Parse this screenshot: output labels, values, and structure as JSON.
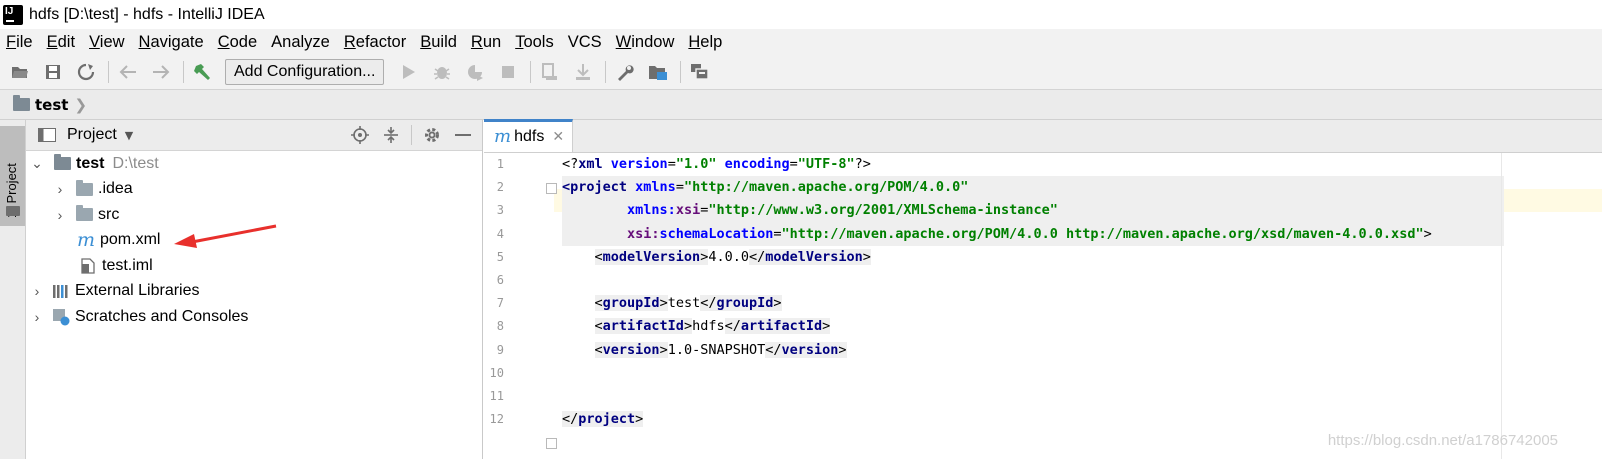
{
  "window": {
    "title": "hdfs [D:\\test] - hdfs - IntelliJ IDEA"
  },
  "menu": [
    {
      "mnemonic": "F",
      "rest": "ile"
    },
    {
      "mnemonic": "E",
      "rest": "dit"
    },
    {
      "mnemonic": "V",
      "rest": "iew"
    },
    {
      "mnemonic": "N",
      "rest": "avigate"
    },
    {
      "mnemonic": "C",
      "rest": "ode"
    },
    {
      "mnemonic": "",
      "rest": "Analyze"
    },
    {
      "mnemonic": "R",
      "rest": "efactor"
    },
    {
      "mnemonic": "B",
      "rest": "uild"
    },
    {
      "mnemonic": "R",
      "rest": "un"
    },
    {
      "mnemonic": "T",
      "rest": "ools"
    },
    {
      "mnemonic": "",
      "rest": "VCS"
    },
    {
      "mnemonic": "W",
      "rest": "indow"
    },
    {
      "mnemonic": "H",
      "rest": "elp"
    }
  ],
  "toolbar": {
    "add_configuration": "Add Configuration..."
  },
  "breadcrumb": {
    "root": "test"
  },
  "left_stripe": {
    "project_tab": "1: Project"
  },
  "project_panel": {
    "title": "Project",
    "tree": {
      "root_name": "test",
      "root_path": "D:\\test",
      "idea": ".idea",
      "src": "src",
      "pom": "pom.xml",
      "iml": "test.iml",
      "external": "External Libraries",
      "scratches": "Scratches and Consoles"
    }
  },
  "editor": {
    "tab": "hdfs",
    "line_numbers": [
      "1",
      "2",
      "3",
      "4",
      "5",
      "6",
      "7",
      "8",
      "9",
      "10",
      "11",
      "12"
    ],
    "code": {
      "l1": {
        "open": "<?",
        "tag": "xml",
        "a1": " version",
        "eq1": "=",
        "v1": "\"1.0\"",
        "a2": " encoding",
        "eq2": "=",
        "v2": "\"UTF-8\"",
        "close": "?>"
      },
      "l2": {
        "open": "<",
        "tag": "project",
        "a1": " xmlns",
        "eq1": "=",
        "v1": "\"http://maven.apache.org/POM/4.0.0\""
      },
      "l3": {
        "indent": "        ",
        "ns": "xmlns:",
        "attr": "xsi",
        "eq": "=",
        "val": "\"http://www.w3.org/2001/XMLSchema-instance\""
      },
      "l4": {
        "indent": "        ",
        "ns": "xsi:",
        "attr": "schemaLocation",
        "eq": "=",
        "val": "\"http://maven.apache.org/POM/4.0.0 http://maven.apache.org/xsd/maven-4.0.0.xsd\"",
        "close": ">"
      },
      "l5": {
        "tag": "modelVersion",
        "text": "4.0.0"
      },
      "l7": {
        "tag": "groupId",
        "text": "test"
      },
      "l8": {
        "tag": "artifactId",
        "text": "hdfs"
      },
      "l9": {
        "tag": "version",
        "text": "1.0-SNAPSHOT"
      },
      "l12": {
        "tag": "project"
      }
    }
  },
  "watermark": "https://blog.csdn.net/a1786742005",
  "colors": {
    "accent": "#4083c9",
    "arrow": "#e8302c"
  }
}
